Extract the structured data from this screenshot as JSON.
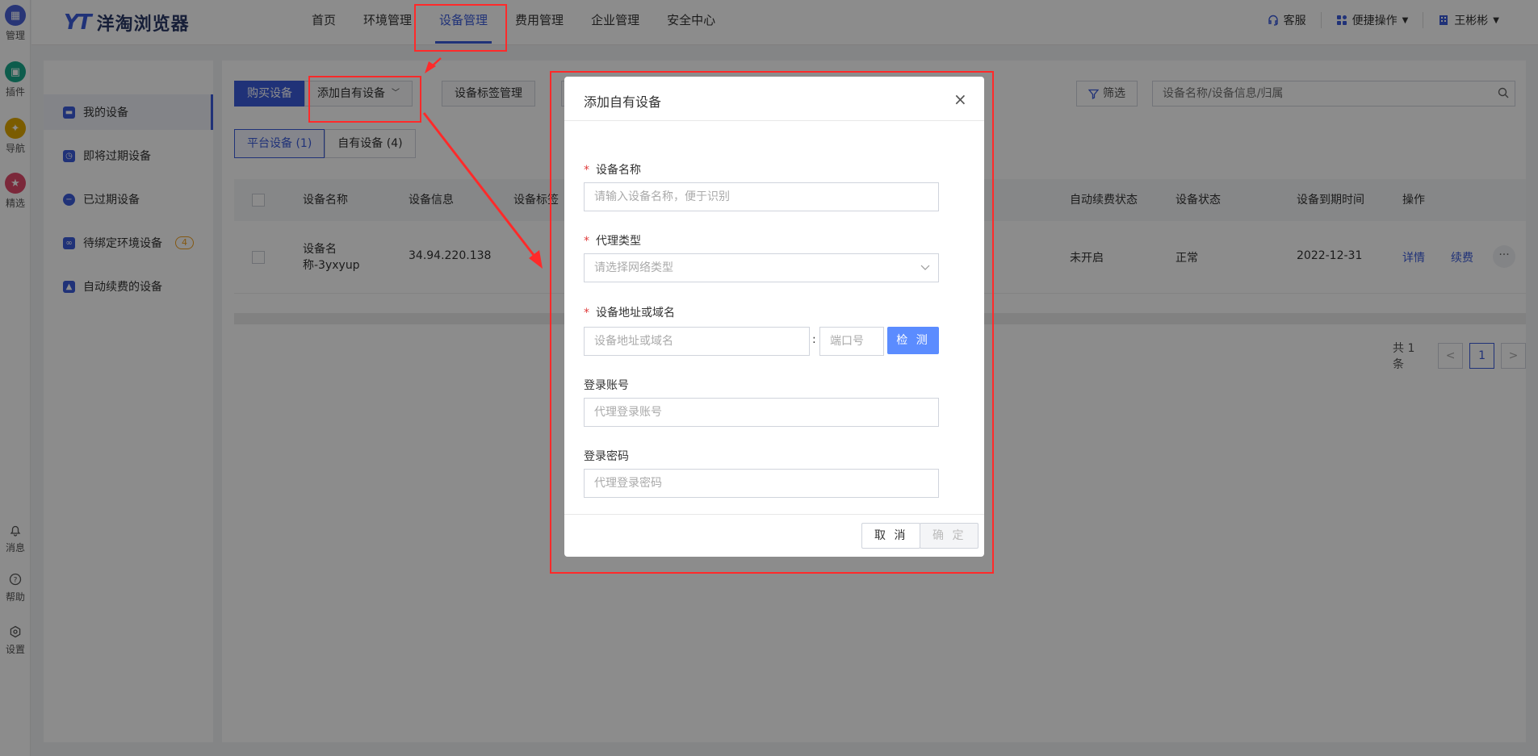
{
  "rail": {
    "top": [
      {
        "label": "管理",
        "color": "#4a62d8"
      },
      {
        "label": "插件",
        "color": "#18a88a"
      },
      {
        "label": "导航",
        "color": "#e0a800"
      },
      {
        "label": "精选",
        "color": "#e04a6a"
      }
    ],
    "bottom": [
      {
        "label": "消息"
      },
      {
        "label": "帮助"
      },
      {
        "label": "设置"
      }
    ]
  },
  "header": {
    "logo_mark": "YT",
    "logo_name": "洋淘浏览器",
    "nav": [
      "首页",
      "环境管理",
      "设备管理",
      "费用管理",
      "企业管理",
      "安全中心"
    ],
    "support": "客服",
    "quick_ops": "便捷操作",
    "user": "王彬彬"
  },
  "sidebar": {
    "items": [
      {
        "label": "我的设备"
      },
      {
        "label": "即将过期设备"
      },
      {
        "label": "已过期设备"
      },
      {
        "label": "待绑定环境设备",
        "badge": "4"
      },
      {
        "label": "自动续费的设备"
      }
    ]
  },
  "toolbar": {
    "buy": "购买设备",
    "add_own": "添加自有设备",
    "tag_manage": "设备标签管理",
    "filter": "筛选",
    "search_placeholder": "设备名称/设备信息/归属"
  },
  "subtabs": [
    "平台设备 (1)",
    "自有设备 (4)"
  ],
  "table": {
    "headers": [
      "设备名称",
      "设备信息",
      "设备标签",
      "自动续费状态",
      "设备状态",
      "设备到期时间",
      "操作"
    ],
    "rows": [
      {
        "name_line1": "设备名",
        "name_line2": "称-3yxyup",
        "info": "34.94.220.138",
        "auto_renew": "未开启",
        "status": "正常",
        "expire": "2022-12-31",
        "detail": "详情",
        "renew": "续费",
        "more": "···"
      }
    ]
  },
  "pagination": {
    "total": "共 1 条",
    "prev": "<",
    "page": "1",
    "next": ">"
  },
  "modal": {
    "title": "添加自有设备",
    "close": "×",
    "name_label": "设备名称",
    "name_placeholder": "请输入设备名称，便于识别",
    "proxy_label": "代理类型",
    "proxy_placeholder": "请选择网络类型",
    "addr_label": "设备地址或域名",
    "addr_placeholder": "设备地址或域名",
    "colon": ":",
    "port_placeholder": "端口号",
    "detect": "检 测",
    "account_label": "登录账号",
    "account_placeholder": "代理登录账号",
    "password_label": "登录密码",
    "password_placeholder": "代理登录密码",
    "cancel": "取 消",
    "confirm": "确 定"
  }
}
